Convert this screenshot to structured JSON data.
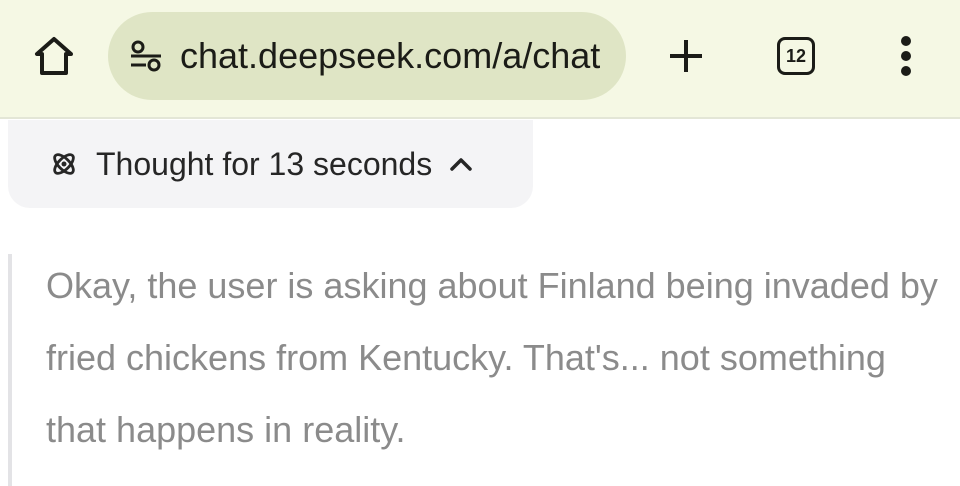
{
  "browser": {
    "url": "chat.deepseek.com/a/chat",
    "tab_count": "12",
    "icons": {
      "home": "home-icon",
      "site_info": "tune-icon",
      "new_tab": "plus-icon",
      "tabs": "tab-switcher-icon",
      "menu": "more-vert-icon"
    },
    "colors": {
      "toolbar_bg": "#f5f8e4",
      "omnibox_bg": "#dfe5c5"
    }
  },
  "thought": {
    "label": "Thought for 13 seconds",
    "icons": {
      "thinking": "atom-icon",
      "toggle": "chevron-up-icon"
    }
  },
  "reasoning": {
    "text": "Okay, the user is asking about Finland being invaded by fried chickens from Kentucky. That's... not something that happens in reality."
  }
}
